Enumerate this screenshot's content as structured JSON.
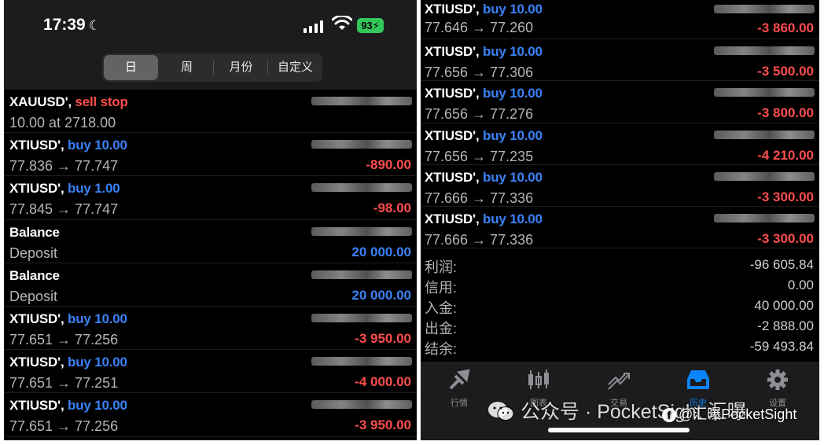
{
  "status": {
    "time": "17:39",
    "battery": "93"
  },
  "segments": [
    "日",
    "周",
    "月份",
    "自定义"
  ],
  "left_rows": [
    {
      "symbol": "XAUUSD',",
      "action": "sell stop",
      "action_type": "sell",
      "detail": "10.00 at 2718.00",
      "amount": "",
      "amount_type": ""
    },
    {
      "symbol": "XTIUSD',",
      "action": "buy 10.00",
      "action_type": "buy",
      "detail": "77.836 → 77.747",
      "amount": "-890.00",
      "amount_type": "neg"
    },
    {
      "symbol": "XTIUSD',",
      "action": "buy 1.00",
      "action_type": "buy",
      "detail": "77.845 → 77.747",
      "amount": "-98.00",
      "amount_type": "neg"
    },
    {
      "symbol": "Balance",
      "action": "",
      "action_type": "",
      "detail": "Deposit",
      "amount": "20 000.00",
      "amount_type": "pos"
    },
    {
      "symbol": "Balance",
      "action": "",
      "action_type": "",
      "detail": "Deposit",
      "amount": "20 000.00",
      "amount_type": "pos"
    },
    {
      "symbol": "XTIUSD',",
      "action": "buy 10.00",
      "action_type": "buy",
      "detail": "77.651 → 77.256",
      "amount": "-3 950.00",
      "amount_type": "neg"
    },
    {
      "symbol": "XTIUSD',",
      "action": "buy 10.00",
      "action_type": "buy",
      "detail": "77.651 → 77.251",
      "amount": "-4 000.00",
      "amount_type": "neg"
    },
    {
      "symbol": "XTIUSD',",
      "action": "buy 10.00",
      "action_type": "buy",
      "detail": "77.651 → 77.256",
      "amount": "-3 950.00",
      "amount_type": "neg"
    }
  ],
  "right_rows": [
    {
      "symbol": "XTIUSD',",
      "action": "buy 10.00",
      "action_type": "buy",
      "detail": "77.646 → 77.260",
      "amount": "-3 860.00",
      "amount_type": "neg"
    },
    {
      "symbol": "XTIUSD',",
      "action": "buy 10.00",
      "action_type": "buy",
      "detail": "77.656 → 77.306",
      "amount": "-3 500.00",
      "amount_type": "neg"
    },
    {
      "symbol": "XTIUSD',",
      "action": "buy 10.00",
      "action_type": "buy",
      "detail": "77.656 → 77.276",
      "amount": "-3 800.00",
      "amount_type": "neg"
    },
    {
      "symbol": "XTIUSD',",
      "action": "buy 10.00",
      "action_type": "buy",
      "detail": "77.656 → 77.235",
      "amount": "-4 210.00",
      "amount_type": "neg"
    },
    {
      "symbol": "XTIUSD',",
      "action": "buy 10.00",
      "action_type": "buy",
      "detail": "77.666 → 77.336",
      "amount": "-3 300.00",
      "amount_type": "neg"
    },
    {
      "symbol": "XTIUSD',",
      "action": "buy 10.00",
      "action_type": "buy",
      "detail": "77.666 → 77.336",
      "amount": "-3 300.00",
      "amount_type": "neg"
    }
  ],
  "summary": [
    {
      "label": "利润:",
      "value": "-96 605.84"
    },
    {
      "label": "信用:",
      "value": "0.00"
    },
    {
      "label": "入金:",
      "value": "40 000.00"
    },
    {
      "label": "出金:",
      "value": "-2 888.00"
    },
    {
      "label": "结余:",
      "value": "-59 493.84"
    }
  ],
  "tabs": [
    {
      "label": "行情",
      "icon": "quotes-icon"
    },
    {
      "label": "图表",
      "icon": "chart-icon"
    },
    {
      "label": "交易",
      "icon": "trade-icon"
    },
    {
      "label": "历史",
      "icon": "history-icon"
    },
    {
      "label": "设置",
      "icon": "gear-icon"
    }
  ],
  "watermark": {
    "main": "公众号 · PocketSight 汇曝",
    "fb": "@汇曝PocketSight"
  },
  "colors": {
    "buy": "#3b82f6",
    "sell": "#ff4d4d",
    "active_tab": "#0a84ff",
    "battery": "#34c759"
  }
}
